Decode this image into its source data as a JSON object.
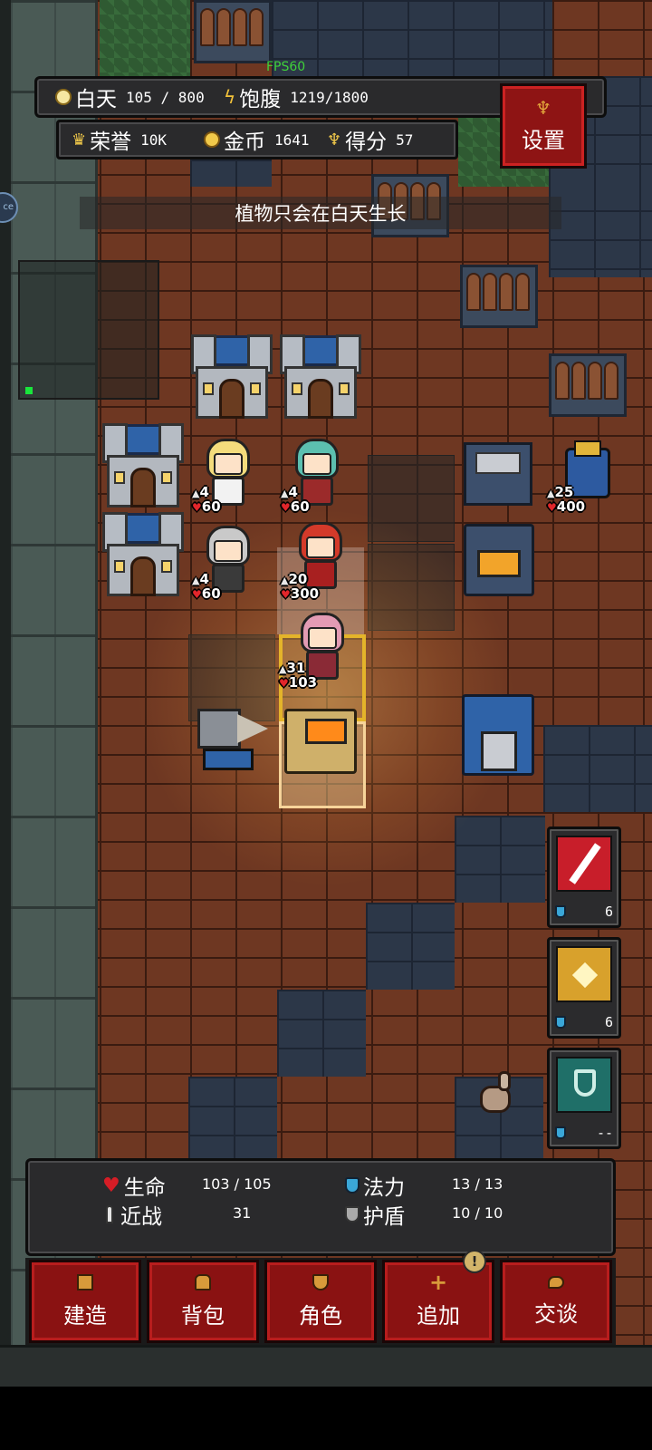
{
  "hud": {
    "fps": "FPS60",
    "day_label": "白天",
    "day_value": "105 / 800",
    "satiety_label": "饱腹",
    "satiety_value": "1219/1800",
    "honor_label": "荣誉",
    "honor_value": "10K",
    "gold_label": "金币",
    "gold_value": "1641",
    "score_label": "得分",
    "score_value": "57",
    "settings_label": "设置"
  },
  "notice": "植物只会在白天生长",
  "edge_badge": "ce",
  "units": [
    {
      "attack": "4",
      "health": "60"
    },
    {
      "attack": "4",
      "health": "60"
    },
    {
      "attack": "4",
      "health": "60"
    },
    {
      "attack": "20",
      "health": "300"
    },
    {
      "attack": "31",
      "health": "103"
    },
    {
      "attack": "25",
      "health": "400"
    }
  ],
  "skills": [
    {
      "icon": "sword-slash-icon",
      "cost": "6",
      "color": "#c81e2a"
    },
    {
      "icon": "golden-rune-icon",
      "cost": "6",
      "color": "#d8a12c"
    },
    {
      "icon": "shield-icon",
      "cost": "--",
      "color": "#1f6f68"
    }
  ],
  "player": {
    "hp_label": "生命",
    "hp_value": "103 / 105",
    "mana_label": "法力",
    "mana_value": "13 / 13",
    "melee_label": "近战",
    "melee_value": "31",
    "shield_label": "护盾",
    "shield_value": "10 / 10"
  },
  "buttons": {
    "build": "建造",
    "backpack": "背包",
    "character": "角色",
    "add": "追加",
    "talk": "交谈",
    "add_badge": "!"
  },
  "colors": {
    "hud_panel": "#2a2a2c",
    "button_red": "#8a1212",
    "health_red": "#d61d26",
    "mana_blue": "#3aa7d8",
    "fps_green": "#3fd13a"
  }
}
